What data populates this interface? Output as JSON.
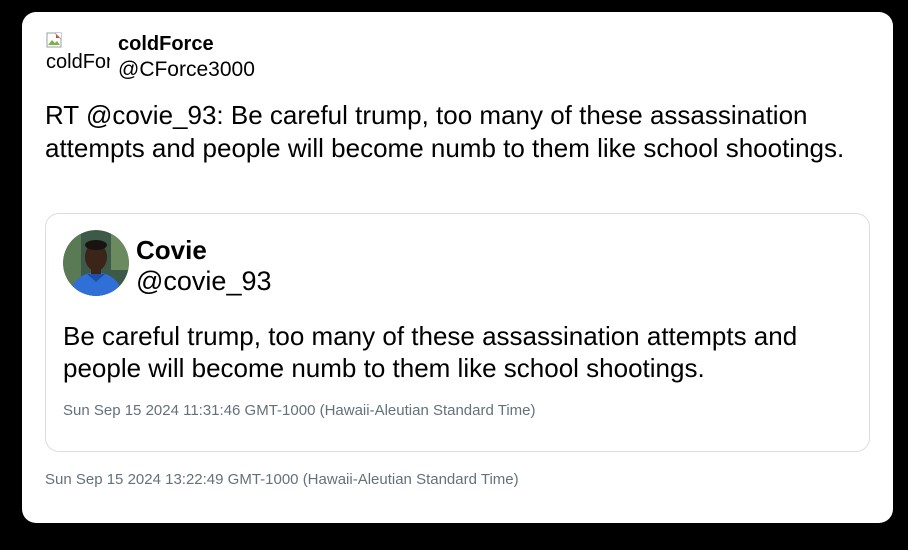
{
  "tweet": {
    "avatar_alt": "coldForce",
    "display_name": "coldForce",
    "handle": "@CForce3000",
    "text": "RT @covie_93: Be careful trump, too many of these assassination attempts and people will become numb to them like school shootings.",
    "timestamp": "Sun Sep 15 2024 13:22:49 GMT-1000 (Hawaii-Aleutian Standard Time)"
  },
  "quoted_tweet": {
    "display_name": "Covie",
    "handle": "@covie_93",
    "text": "Be careful trump, too many of these assassination attempts and people will become numb to them like school shootings.",
    "timestamp": "Sun Sep 15 2024 11:31:46 GMT-1000 (Hawaii-Aleutian Standard Time)"
  },
  "colors": {
    "page_background": "#000000",
    "card_background": "#ffffff",
    "text": "#000000",
    "timestamp": "#65707b",
    "quote_border": "#d9dde1"
  }
}
